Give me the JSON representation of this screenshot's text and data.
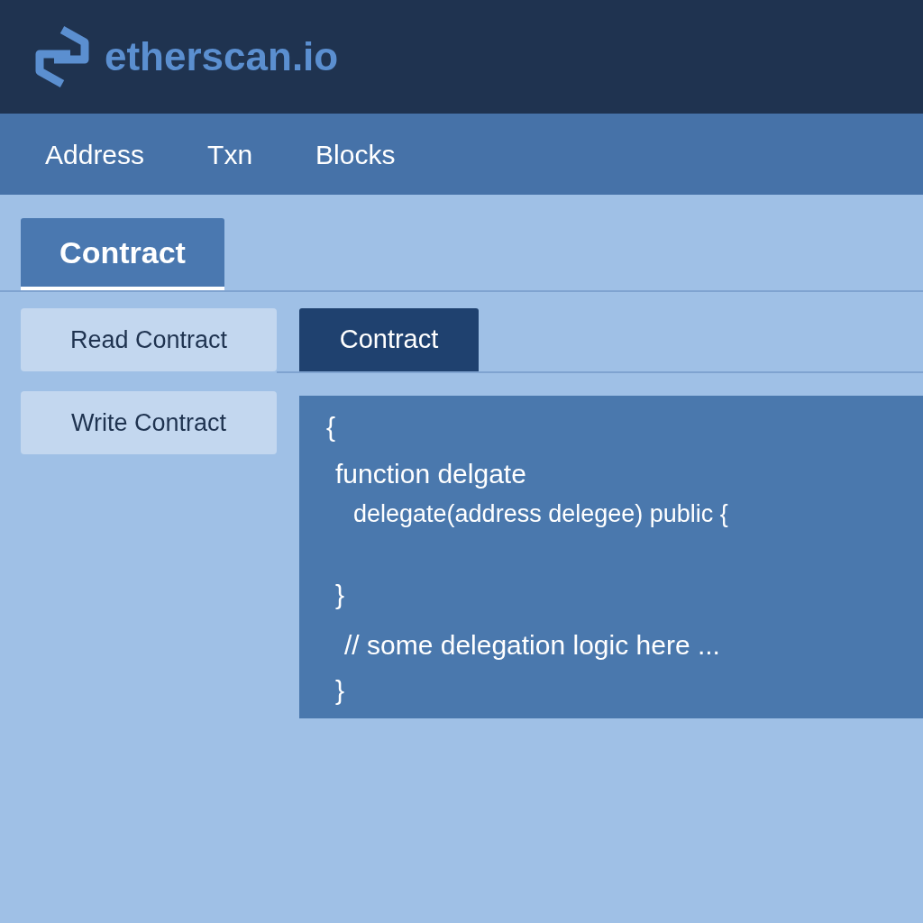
{
  "header": {
    "logo_text": "etherscan.io"
  },
  "nav": [
    {
      "label": "Address",
      "selected": false
    },
    {
      "label": "Txn",
      "selected": false
    },
    {
      "label": "Blocks",
      "selected": false
    }
  ],
  "tabs": [
    {
      "label": "Contract",
      "selected": true
    }
  ],
  "side_buttons": [
    {
      "label": "Read Contract",
      "selected": false
    },
    {
      "label": "Write Contract",
      "selected": false
    }
  ],
  "sub_tabs": [
    {
      "label": "Contract",
      "selected": true
    }
  ],
  "code_lines": [
    "{",
    "function delgate",
    "delegate(address delegee) public {",
    "}",
    "// some delegation logic here ...",
    "}"
  ]
}
